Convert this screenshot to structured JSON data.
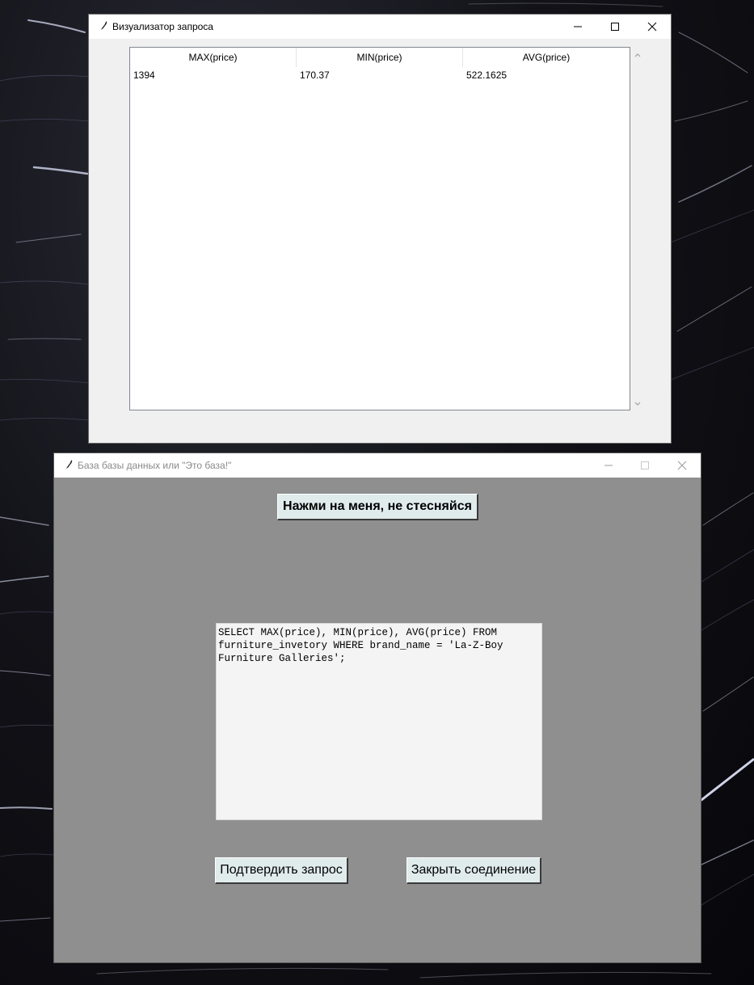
{
  "visualizer_window": {
    "title": "Визуализатор запроса",
    "table": {
      "columns": [
        "MAX(price)",
        "MIN(price)",
        "AVG(price)"
      ],
      "rows": [
        [
          "1394",
          "170.37",
          "522.1625"
        ]
      ]
    }
  },
  "main_window": {
    "title": "База базы данных или \"Это база!\"",
    "press_me_button": "Нажми на меня, не стесняйся",
    "query_text": "SELECT MAX(price), MIN(price), AVG(price) FROM\nfurniture_invetory WHERE brand_name = 'La-Z-Boy\nFurniture Galleries';",
    "confirm_button": "Подтвердить запрос",
    "close_connection_button": "Закрыть соединение"
  },
  "colors": {
    "desktop_background": "#0d0d14",
    "main_window_background": "#8f8f8f",
    "button_background": "#e0ebeb"
  }
}
